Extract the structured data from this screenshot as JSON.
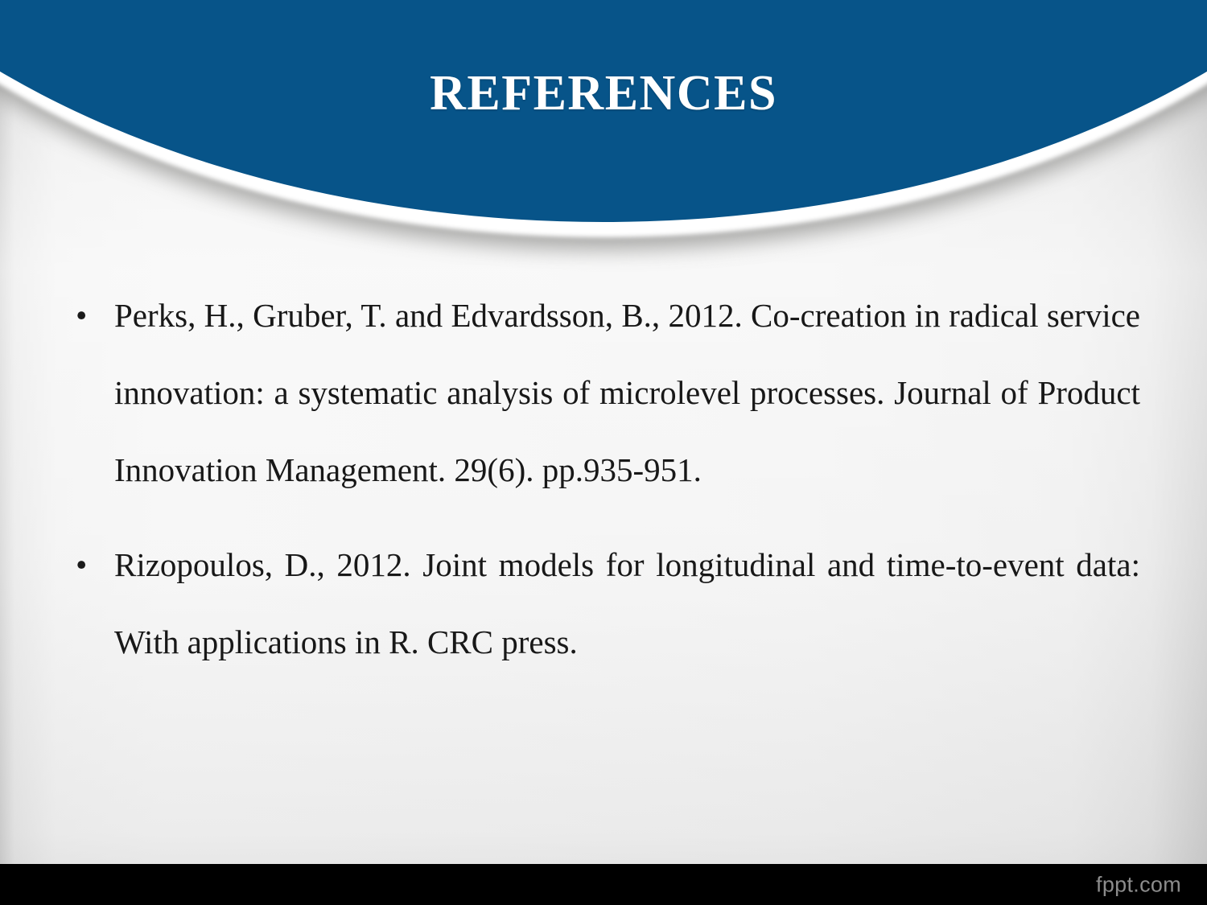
{
  "slide": {
    "title": "REFERENCES",
    "accent_color": "#075489",
    "background_color": "#f0f0f0",
    "text_color": "#181818",
    "title_color": "#ffffff"
  },
  "references": [
    {
      "bullet": "•",
      "text": "Perks, H., Gruber, T. and Edvardsson, B., 2012. Co-creation in radical service innovation: a systematic analysis of microlevel processes. Journal of Product Innovation Management. 29(6). pp.935-951."
    },
    {
      "bullet": "•",
      "text": "Rizopoulos, D., 2012. Joint models for longitudinal and time-to-event data: With applications in R. CRC press."
    }
  ],
  "footer": {
    "watermark": "fppt.com",
    "bar_color": "#000000"
  }
}
